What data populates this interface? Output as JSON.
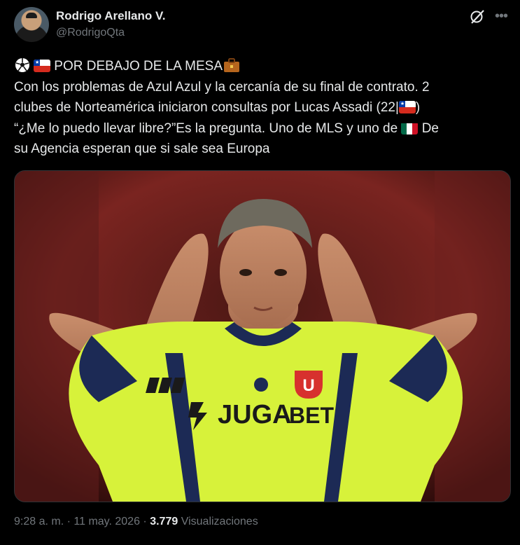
{
  "author": {
    "name": "Rodrigo Arellano V.",
    "handle": "@RodrigoQta"
  },
  "tweet": {
    "line1": "POR DEBAJO DE LA MESA",
    "line2": "Con los problemas de Azul Azul y la cercanía de su final de contrato. 2",
    "line3a": "clubes de Norteamérica iniciaron consultas por Lucas Assadi (22|",
    "line3b": ")",
    "line4a": "“¿Me lo puedo llevar libre?”Es la pregunta. Uno de MLS y uno de",
    "line4b": "De",
    "line5": "su Agencia esperan que si sale sea Europa"
  },
  "media": {
    "kit_sponsor": "JUGABET",
    "kit_sponsor_a": "JUGA",
    "kit_sponsor_b": "BET",
    "crest_letter": "U"
  },
  "meta": {
    "time": "9:28 a. m.",
    "sep1": "·",
    "date": "11 may. 2026",
    "sep2": "·",
    "views": "3.779",
    "views_label": "Visualizaciones"
  },
  "icons": {
    "grok": "grok-icon",
    "more": "more-icon",
    "soccer": "soccer-ball-icon",
    "flag_chile": "flag-chile-icon",
    "flag_mexico": "flag-mexico-icon",
    "briefcase": "briefcase-icon"
  },
  "colors": {
    "background": "#000000",
    "text": "#e7e9ea",
    "secondary": "#71767b",
    "jersey": "#d7f23a"
  }
}
